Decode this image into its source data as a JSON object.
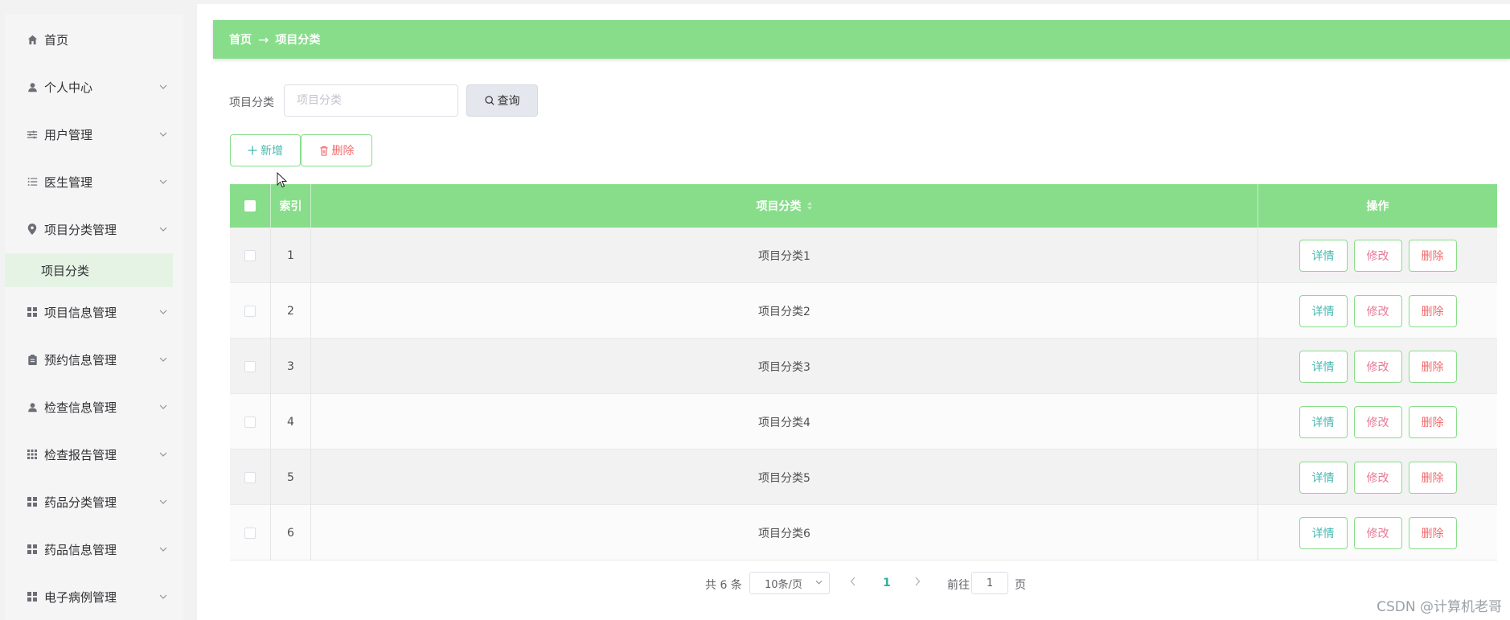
{
  "sidebar": {
    "items": [
      {
        "label": "首页",
        "icon": "home-icon"
      },
      {
        "label": "个人中心",
        "icon": "user-icon"
      },
      {
        "label": "用户管理",
        "icon": "sliders-icon"
      },
      {
        "label": "医生管理",
        "icon": "list-icon"
      },
      {
        "label": "项目分类管理",
        "icon": "location-icon"
      },
      {
        "label": "项目信息管理",
        "icon": "grid-icon"
      },
      {
        "label": "预约信息管理",
        "icon": "clipboard-icon"
      },
      {
        "label": "检查信息管理",
        "icon": "user-icon"
      },
      {
        "label": "检查报告管理",
        "icon": "apps-icon"
      },
      {
        "label": "药品分类管理",
        "icon": "grid-icon"
      },
      {
        "label": "药品信息管理",
        "icon": "grid-icon"
      },
      {
        "label": "电子病例管理",
        "icon": "grid-icon"
      }
    ],
    "active_sub": "项目分类"
  },
  "breadcrumb": {
    "home": "首页",
    "sep": "→",
    "current": "项目分类"
  },
  "search": {
    "label": "项目分类",
    "placeholder": "项目分类",
    "button": "查询"
  },
  "actions": {
    "add": "新增",
    "delete": "删除"
  },
  "table": {
    "headers": {
      "index": "索引",
      "name": "项目分类",
      "ops": "操作"
    },
    "rows": [
      {
        "index": "1",
        "name": "项目分类1"
      },
      {
        "index": "2",
        "name": "项目分类2"
      },
      {
        "index": "3",
        "name": "项目分类3"
      },
      {
        "index": "4",
        "name": "项目分类4"
      },
      {
        "index": "5",
        "name": "项目分类5"
      },
      {
        "index": "6",
        "name": "项目分类6"
      }
    ],
    "op_labels": {
      "detail": "详情",
      "edit": "修改",
      "remove": "删除"
    }
  },
  "pagination": {
    "total": "共 6 条",
    "page_size": "10条/页",
    "current": "1",
    "goto": "前往",
    "goto_value": "1",
    "page_suffix": "页"
  },
  "watermark": "CSDN @计算机老哥",
  "colors": {
    "accent": "#88dd8a",
    "detail": "#47b7b0",
    "edit": "#e67896",
    "danger": "#f26b6b"
  }
}
